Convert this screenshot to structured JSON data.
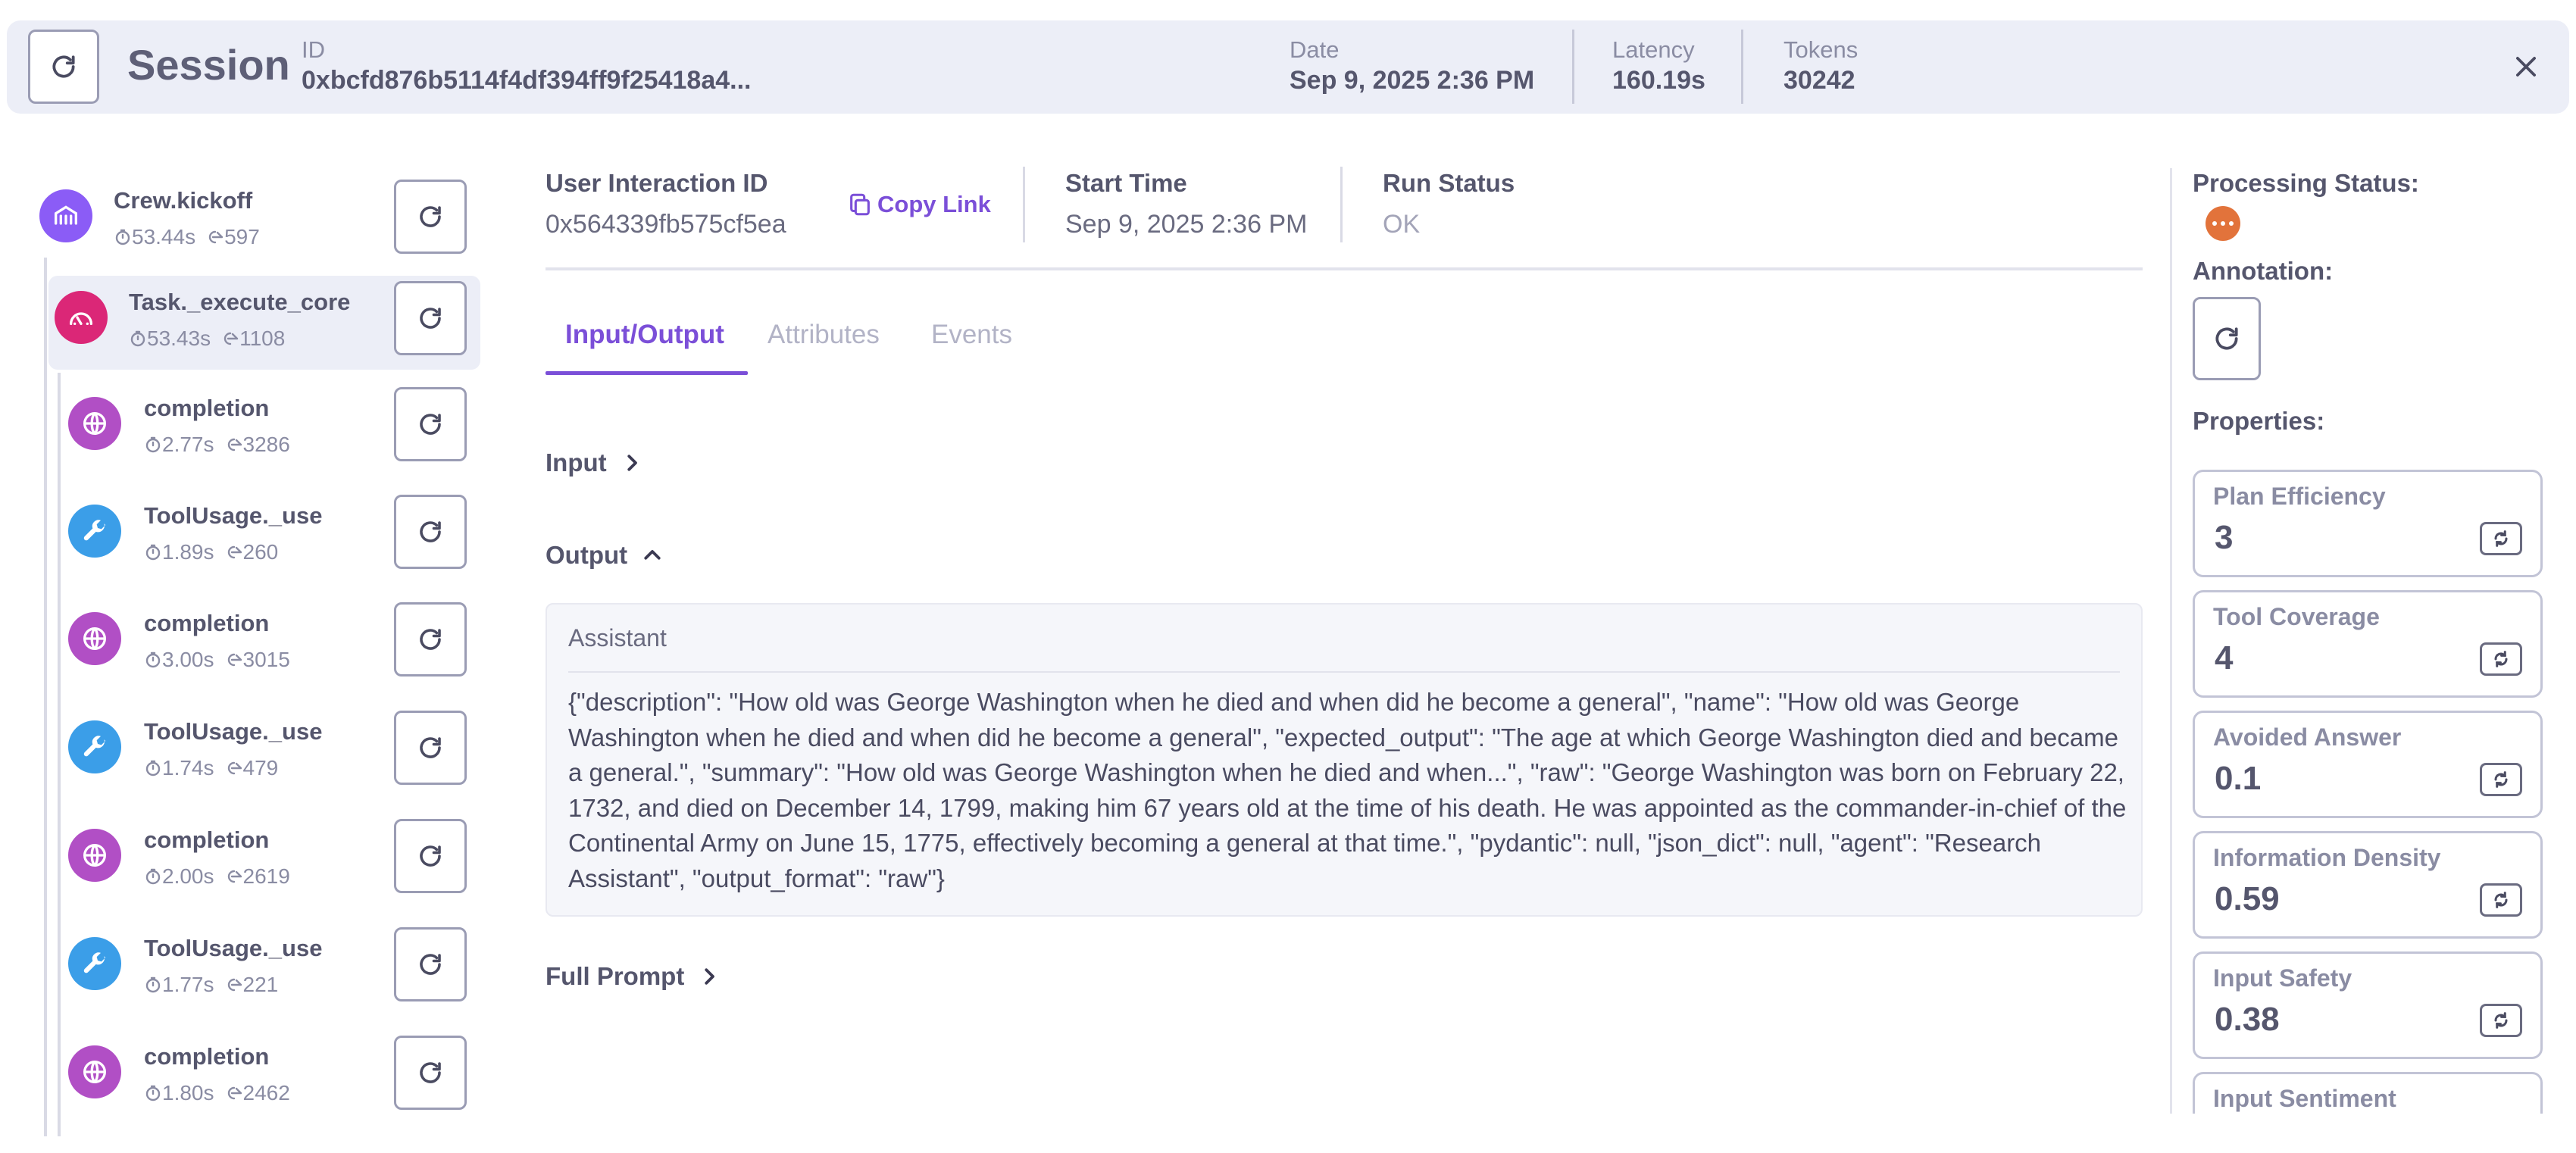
{
  "header": {
    "title": "Session",
    "id_label": "ID",
    "id_value": "0xbcfd876b5114f4df394ff9f25418a4...",
    "date_label": "Date",
    "date_value": "Sep 9, 2025 2:36 PM",
    "latency_label": "Latency",
    "latency_value": "160.19s",
    "tokens_label": "Tokens",
    "tokens_value": "30242"
  },
  "tree": [
    {
      "name": "Crew.kickoff",
      "time": "53.44s",
      "tokens": "597",
      "icon": "crew-icon",
      "color": "#8b5cf6"
    },
    {
      "name": "Task._execute_core",
      "time": "53.43s",
      "tokens": "1108",
      "icon": "gauge-icon",
      "color": "#db2777"
    },
    {
      "name": "completion",
      "time": "2.77s",
      "tokens": "3286",
      "icon": "globe-icon",
      "color": "#b14fc5"
    },
    {
      "name": "ToolUsage._use",
      "time": "1.89s",
      "tokens": "260",
      "icon": "wrench-icon",
      "color": "#3b9ee8"
    },
    {
      "name": "completion",
      "time": "3.00s",
      "tokens": "3015",
      "icon": "globe-icon",
      "color": "#b14fc5"
    },
    {
      "name": "ToolUsage._use",
      "time": "1.74s",
      "tokens": "479",
      "icon": "wrench-icon",
      "color": "#3b9ee8"
    },
    {
      "name": "completion",
      "time": "2.00s",
      "tokens": "2619",
      "icon": "globe-icon",
      "color": "#b14fc5"
    },
    {
      "name": "ToolUsage._use",
      "time": "1.77s",
      "tokens": "221",
      "icon": "wrench-icon",
      "color": "#3b9ee8"
    },
    {
      "name": "completion",
      "time": "1.80s",
      "tokens": "2462",
      "icon": "globe-icon",
      "color": "#b14fc5"
    }
  ],
  "details": {
    "user_interaction_label": "User Interaction ID",
    "user_interaction_value": "0x564339fb575cf5ea",
    "copy_link_label": "Copy Link",
    "start_time_label": "Start Time",
    "start_time_value": "Sep 9, 2025 2:36 PM",
    "run_status_label": "Run Status",
    "run_status_value": "OK"
  },
  "tabs": [
    "Input/Output",
    "Attributes",
    "Events"
  ],
  "io": {
    "input_label": "Input",
    "output_label": "Output",
    "output_role": "Assistant",
    "output_text": "{\"description\": \"How old was George Washington when he died and when did he become a general\", \"name\": \"How old was George Washington when he died and when did he become a general\", \"expected_output\": \"The age at which George Washington died and became a general.\", \"summary\": \"How old was George Washington when he died and when...\", \"raw\": \"George Washington was born on February 22, 1732, and died on December 14, 1799, making him 67 years old at the time of his death. He was appointed as the commander-in-chief of the Continental Army on June 15, 1775, effectively becoming a general at that time.\", \"pydantic\": null, \"json_dict\": null, \"agent\": \"Research Assistant\", \"output_format\": \"raw\"}",
    "full_prompt_label": "Full Prompt"
  },
  "right_panel": {
    "processing_status_label": "Processing Status:",
    "annotation_label": "Annotation:",
    "properties_label": "Properties:",
    "properties": [
      {
        "name": "Plan Efficiency",
        "value": "3"
      },
      {
        "name": "Tool Coverage",
        "value": "4"
      },
      {
        "name": "Avoided Answer",
        "value": "0.1"
      },
      {
        "name": "Information Density",
        "value": "0.59"
      },
      {
        "name": "Input Safety",
        "value": "0.38"
      },
      {
        "name": "Input Sentiment",
        "value": ""
      }
    ]
  },
  "colors": {
    "accent": "#7b4fd8",
    "status_processing": "#e2733b"
  }
}
